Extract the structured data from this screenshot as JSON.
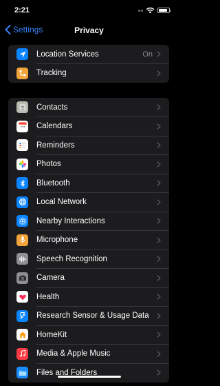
{
  "status": {
    "time": "2:21",
    "battery_level": 0.85
  },
  "nav": {
    "back_label": "Settings",
    "title": "Privacy"
  },
  "groups": [
    {
      "items": [
        {
          "label": "Location Services",
          "value": "On",
          "icon": "location-arrow-icon",
          "color": "#0a84ff"
        },
        {
          "label": "Tracking",
          "value": "",
          "icon": "tracking-icon",
          "color": "#f2a33a"
        }
      ]
    },
    {
      "items": [
        {
          "label": "Contacts",
          "icon": "contacts-icon",
          "color": "#b9b9b0"
        },
        {
          "label": "Calendars",
          "icon": "calendar-icon",
          "color": "#ffffff"
        },
        {
          "label": "Reminders",
          "icon": "reminders-icon",
          "color": "#ffffff"
        },
        {
          "label": "Photos",
          "icon": "photos-icon",
          "color": "#ffffff"
        },
        {
          "label": "Bluetooth",
          "icon": "bluetooth-icon",
          "color": "#0a84ff"
        },
        {
          "label": "Local Network",
          "icon": "globe-icon",
          "color": "#0a84ff"
        },
        {
          "label": "Nearby Interactions",
          "icon": "nearby-icon",
          "color": "#0a84ff"
        },
        {
          "label": "Microphone",
          "icon": "microphone-icon",
          "color": "#f2a33a"
        },
        {
          "label": "Speech Recognition",
          "icon": "waveform-icon",
          "color": "#8e8e93"
        },
        {
          "label": "Camera",
          "icon": "camera-icon",
          "color": "#8e8e93"
        },
        {
          "label": "Health",
          "icon": "heart-icon",
          "color": "#ffffff"
        },
        {
          "label": "Research Sensor & Usage Data",
          "icon": "research-icon",
          "color": "#0a84ff"
        },
        {
          "label": "HomeKit",
          "icon": "home-icon",
          "color": "#ffffff"
        },
        {
          "label": "Media & Apple Music",
          "icon": "music-icon",
          "color": "#fc3c44"
        },
        {
          "label": "Files and Folders",
          "icon": "folder-icon",
          "color": "#1a8cff"
        }
      ]
    }
  ]
}
